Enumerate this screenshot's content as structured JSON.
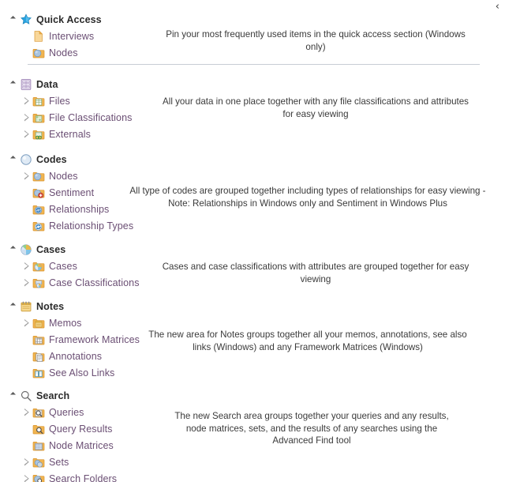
{
  "corner": {
    "collapse_chevron": "‹"
  },
  "sections": [
    {
      "id": "quick-access",
      "header": {
        "label": "Quick Access",
        "icon": "star-icon",
        "state": "expanded"
      },
      "children": [
        {
          "label": "Interviews",
          "icon": "folder-document-icon",
          "expandable": false
        },
        {
          "label": "Nodes",
          "icon": "folder-node-icon",
          "expandable": false
        }
      ],
      "description": "Pin your most frequently used items in the quick access section (Windows only)"
    },
    {
      "id": "data",
      "header": {
        "label": "Data",
        "icon": "data-grid-icon",
        "state": "expanded"
      },
      "children": [
        {
          "label": "Files",
          "icon": "folder-files-icon",
          "expandable": true
        },
        {
          "label": "File Classifications",
          "icon": "folder-file-classifications-icon",
          "expandable": true
        },
        {
          "label": "Externals",
          "icon": "folder-externals-icon",
          "expandable": true
        }
      ],
      "description": "All your data in one place together with any file classifications and attributes for easy viewing"
    },
    {
      "id": "codes",
      "header": {
        "label": "Codes",
        "icon": "node-circle-icon",
        "state": "expanded"
      },
      "children": [
        {
          "label": "Nodes",
          "icon": "folder-node-icon",
          "expandable": true
        },
        {
          "label": "Sentiment",
          "icon": "folder-sentiment-icon",
          "expandable": false
        },
        {
          "label": "Relationships",
          "icon": "folder-relationships-icon",
          "expandable": false
        },
        {
          "label": "Relationship Types",
          "icon": "folder-relationship-types-icon",
          "expandable": false
        }
      ],
      "description": "All type of codes are grouped together including types of relationships for easy viewing - Note: Relationships in Windows only and Sentiment in Windows Plus"
    },
    {
      "id": "cases",
      "header": {
        "label": "Cases",
        "icon": "pie-case-icon",
        "state": "expanded"
      },
      "children": [
        {
          "label": "Cases",
          "icon": "folder-cases-icon",
          "expandable": true
        },
        {
          "label": "Case Classifications",
          "icon": "folder-case-classifications-icon",
          "expandable": true
        }
      ],
      "description": "Cases and case classifications with attributes are grouped together for easy viewing"
    },
    {
      "id": "notes",
      "header": {
        "label": "Notes",
        "icon": "memo-pad-icon",
        "state": "expanded"
      },
      "children": [
        {
          "label": "Memos",
          "icon": "folder-memos-icon",
          "expandable": true
        },
        {
          "label": "Framework Matrices",
          "icon": "folder-framework-matrices-icon",
          "expandable": false
        },
        {
          "label": "Annotations",
          "icon": "folder-annotations-icon",
          "expandable": false
        },
        {
          "label": "See Also Links",
          "icon": "folder-see-also-links-icon",
          "expandable": false
        }
      ],
      "description": "The new area for Notes groups together all your memos, annotations, see also links (Windows) and any Framework Matrices (Windows)"
    },
    {
      "id": "search",
      "header": {
        "label": "Search",
        "icon": "magnifier-icon",
        "state": "expanded"
      },
      "children": [
        {
          "label": "Queries",
          "icon": "folder-queries-icon",
          "expandable": true
        },
        {
          "label": "Query Results",
          "icon": "folder-query-results-icon",
          "expandable": false
        },
        {
          "label": "Node Matrices",
          "icon": "folder-node-matrices-icon",
          "expandable": false
        },
        {
          "label": "Sets",
          "icon": "folder-sets-icon",
          "expandable": true
        },
        {
          "label": "Search Folders",
          "icon": "folder-search-folders-icon",
          "expandable": true
        }
      ],
      "description": "The new Search area groups together your queries and any results, node matrices, sets, and the results of any searches using the Advanced Find tool"
    }
  ],
  "colors": {
    "header_text": "#2b2b2b",
    "child_text": "#6b4f74",
    "description_text": "#3a3a3a",
    "divider": "#c8cdd4",
    "folder": "#f0b450",
    "star": "#29a3e0",
    "node_blue": "#a8c4e0"
  }
}
